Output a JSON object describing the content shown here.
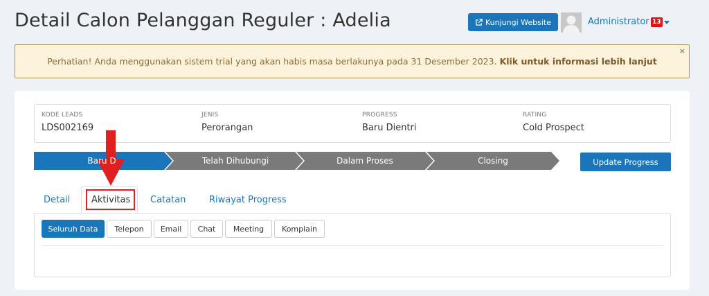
{
  "page": {
    "title": "Detail Calon Pelanggan Reguler : Adelia"
  },
  "header": {
    "visit_button": "Kunjungi Website",
    "user_name": "Administrator",
    "notification_count": "13"
  },
  "alert": {
    "message": "Perhatian! Anda menggunakan sistem trial yang akan habis masa berlakunya pada 31 Desember 2023.",
    "link": "Klik untuk informasi lebih lanjut",
    "close": "×"
  },
  "info": {
    "kode_label": "KODE LEADS",
    "kode_value": "LDS002169",
    "jenis_label": "JENIS",
    "jenis_value": "Perorangan",
    "progress_label": "PROGRESS",
    "progress_value": "Baru Dientri",
    "rating_label": "RATING",
    "rating_value": "Cold Prospect"
  },
  "steps": [
    "Baru D",
    "Telah Dihubungi",
    "Dalam Proses",
    "Closing"
  ],
  "update_button": "Update Progress",
  "tabs": [
    "Detail",
    "Aktivitas",
    "Catatan",
    "Riwayat Progress"
  ],
  "filters": [
    "Seluruh Data",
    "Telepon",
    "Email",
    "Chat",
    "Meeting",
    "Komplain"
  ],
  "colors": {
    "primary": "#1a75bb",
    "step_inactive": "#7a7a7a",
    "annotation": "#e02020"
  }
}
